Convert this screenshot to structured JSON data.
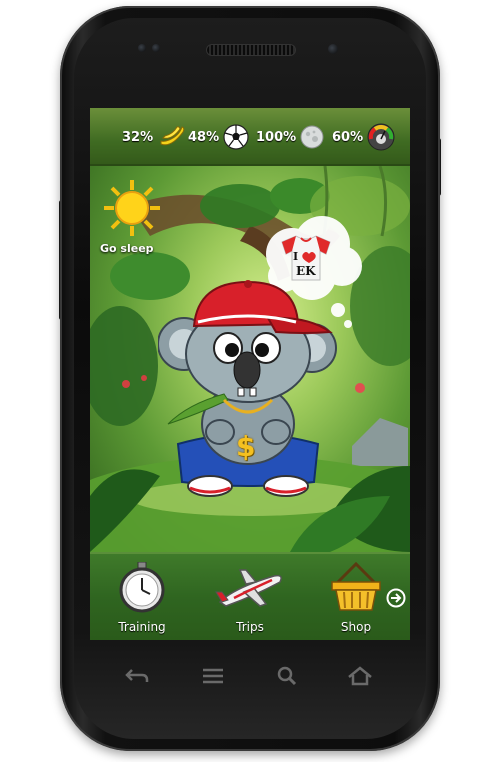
{
  "stats": [
    {
      "value": "32%",
      "icon": "banana-icon"
    },
    {
      "value": "48%",
      "icon": "soccer-ball-icon"
    },
    {
      "value": "100%",
      "icon": "moon-icon"
    },
    {
      "value": "60%",
      "icon": "gauge-icon"
    }
  ],
  "scene": {
    "sleep_label": "Go sleep",
    "thought_shirt_text_top": "I",
    "thought_shirt_text_bottom": "EK",
    "necklace_symbol": "$"
  },
  "bottom_nav": {
    "training": "Training",
    "trips": "Trips",
    "shop": "Shop"
  },
  "colors": {
    "status_green": "#3f6b22",
    "nav_green": "#2f6520",
    "cap_red": "#d8202a",
    "pants_blue": "#2450b8"
  }
}
